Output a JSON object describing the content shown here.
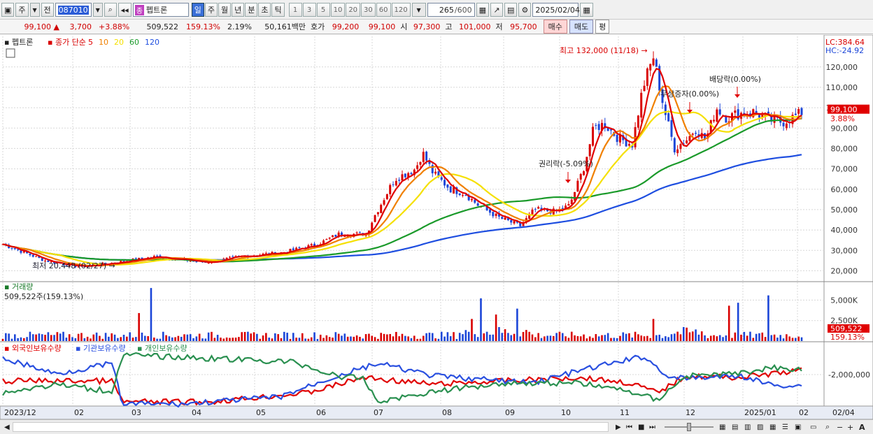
{
  "toolbar": {
    "period": "주",
    "type": "전",
    "code": "087010",
    "stock_badge": "종",
    "stock_name": "펩트론",
    "tab_labels": [
      "일",
      "주",
      "월",
      "년",
      "분",
      "초",
      "틱"
    ],
    "active_tab": "일",
    "interval_labels": [
      "1",
      "3",
      "5",
      "10",
      "20",
      "30",
      "60",
      "120"
    ],
    "count": "265",
    "count_total": "/600",
    "date": "2025/02/04"
  },
  "info": {
    "price": "99,100",
    "change": "3,700",
    "change_pct": "+3.88%",
    "volume": "509,522",
    "volume_ratio": "159.13%",
    "turnover": "2.19%",
    "amount": "50,161백만",
    "bid_label": "호가",
    "bid1": "99,200",
    "bid2": "99,100",
    "open_label": "시",
    "open": "97,300",
    "high_label": "고",
    "high": "101,000",
    "low_label": "저",
    "low": "95,700",
    "buy": "매수",
    "sell": "매도",
    "eval": "평"
  },
  "main_panel": {
    "stock_legend": "펩트론",
    "ma_label": "종가 단순",
    "ma_periods": [
      "5",
      "10",
      "20",
      "60",
      "120"
    ],
    "lc": "LC:384.64",
    "hc": "HC:-24.92",
    "y_ticks": [
      "120,000",
      "110,000",
      "100,000",
      "90,000",
      "80,000",
      "70,000",
      "60,000",
      "50,000",
      "40,000",
      "30,000",
      "20,000"
    ],
    "price_tag": "99,100",
    "pct_tag": "3.88%",
    "annotations": {
      "high": "최고 132,000 (11/18)",
      "low": "최저 20,448 (02/27)",
      "rights": "권리락(-5.09%)",
      "bonus": "무상증자(0.00%)",
      "dividend": "배당락(0.00%)"
    }
  },
  "volume_panel": {
    "title": "거래량",
    "value": "509,522주(159.13%)",
    "y_ticks": [
      "5,000K",
      "2,500K"
    ],
    "tag_value": "509,522",
    "tag_pct": "159.13%"
  },
  "holding_panel": {
    "foreign": "외국인보유수량",
    "institution": "기관보유수량",
    "individual": "개인보유수량",
    "y_tick": "-2,000,000"
  },
  "x_axis": {
    "labels": [
      "2023/12",
      "02",
      "03",
      "04",
      "05",
      "06",
      "07",
      "08",
      "09",
      "10",
      "11",
      "12",
      "2025/01",
      "02",
      "02/04"
    ]
  },
  "colors": {
    "up": "#d90000",
    "down": "#1c46d8",
    "ma5": "#e00000",
    "ma10": "#f08000",
    "ma20": "#f5e000",
    "ma60": "#1a9a2a",
    "ma120": "#1e4ee0",
    "foreign": "#e00000",
    "institution": "#2a50e0",
    "individual": "#2a9050"
  },
  "chart_data": {
    "type": "line",
    "title": "펩트론",
    "x": [
      "2023/12",
      "02",
      "03",
      "04",
      "05",
      "06",
      "07",
      "08",
      "09",
      "10",
      "11",
      "12",
      "2025/01",
      "02"
    ],
    "series": [
      {
        "name": "종가",
        "values": [
          33000,
          27000,
          23000,
          26000,
          28000,
          32000,
          40000,
          72000,
          52000,
          47000,
          85000,
          110000,
          97000,
          99100
        ]
      },
      {
        "name": "120",
        "values": [
          33000,
          32000,
          31000,
          30000,
          29000,
          29500,
          30000,
          36000,
          42000,
          47000,
          55000,
          65000,
          75000,
          79000
        ]
      }
    ],
    "ylim": [
      15000,
      135000
    ]
  }
}
